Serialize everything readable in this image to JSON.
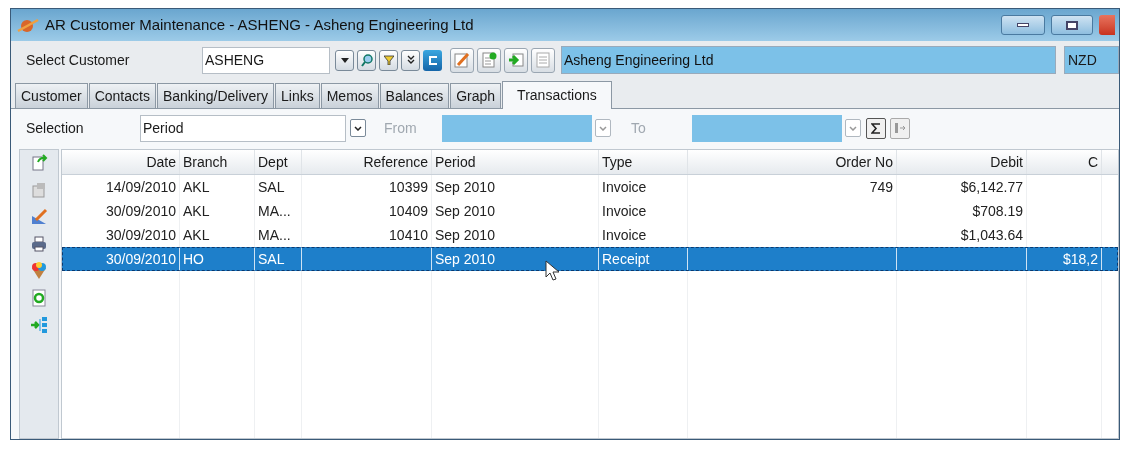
{
  "window": {
    "title": "AR Customer Maintenance - ASHENG - Asheng Engineering Ltd"
  },
  "customer_bar": {
    "label": "Select Customer",
    "code": "ASHENG",
    "name": "Asheng Engineering Ltd",
    "currency": "NZD"
  },
  "tabs": [
    {
      "label": "Customer",
      "selected": false
    },
    {
      "label": "Contacts",
      "selected": false
    },
    {
      "label": "Banking/Delivery",
      "selected": false
    },
    {
      "label": "Links",
      "selected": false
    },
    {
      "label": "Memos",
      "selected": false
    },
    {
      "label": "Balances",
      "selected": false
    },
    {
      "label": "Graph",
      "selected": false
    },
    {
      "label": "Transactions",
      "selected": true
    }
  ],
  "selection": {
    "label": "Selection",
    "value": "Period",
    "from_label": "From",
    "to_label": "To"
  },
  "table": {
    "columns": [
      "Date",
      "Branch",
      "Dept",
      "Reference",
      "Period",
      "Type",
      "Order No",
      "Debit",
      "C"
    ],
    "rows": [
      {
        "cells": [
          "14/09/2010",
          "AKL",
          "SAL",
          "10399",
          "Sep 2010",
          "Invoice",
          "749",
          "$6,142.77",
          ""
        ],
        "selected": false
      },
      {
        "cells": [
          "30/09/2010",
          "AKL",
          "MA...",
          "10409",
          "Sep 2010",
          "Invoice",
          "",
          "$708.19",
          ""
        ],
        "selected": false
      },
      {
        "cells": [
          "30/09/2010",
          "AKL",
          "MA...",
          "10410",
          "Sep 2010",
          "Invoice",
          "",
          "$1,043.64",
          ""
        ],
        "selected": false
      },
      {
        "cells": [
          "30/09/2010",
          "HO",
          "SAL",
          "",
          "Sep 2010",
          "Receipt",
          "",
          "",
          "$18,2"
        ],
        "selected": true
      }
    ]
  }
}
